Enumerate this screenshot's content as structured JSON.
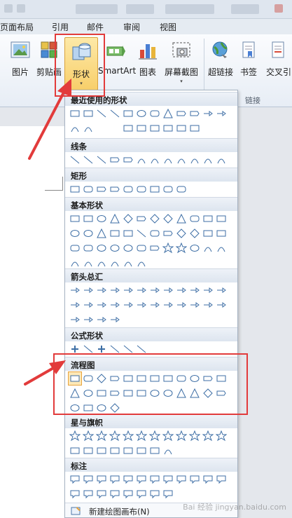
{
  "tabs": [
    "页面布局",
    "引用",
    "邮件",
    "审阅",
    "视图"
  ],
  "ribbon": {
    "buttons": [
      {
        "label": "图片",
        "icon": "picture-icon"
      },
      {
        "label": "剪贴画",
        "icon": "clipart-icon"
      },
      {
        "label": "形状",
        "icon": "shapes-icon",
        "dropdown": "▾"
      },
      {
        "label": "SmartArt",
        "icon": "smartart-icon"
      },
      {
        "label": "图表",
        "icon": "chart-icon"
      },
      {
        "label": "屏幕截图",
        "icon": "screenshot-icon",
        "dropdown": "▾"
      },
      {
        "label": "超链接",
        "icon": "hyperlink-icon"
      },
      {
        "label": "书签",
        "icon": "bookmark-icon"
      },
      {
        "label": "交叉引",
        "icon": "crossref-icon"
      }
    ],
    "group_links": "链接"
  },
  "gallery": {
    "sections": [
      {
        "title": "最近使用的形状",
        "count": 22
      },
      {
        "title": "线条",
        "count": 12
      },
      {
        "title": "矩形",
        "count": 9
      },
      {
        "title": "基本形状",
        "count": 42
      },
      {
        "title": "箭头总汇",
        "count": 28
      },
      {
        "title": "公式形状",
        "count": 6
      },
      {
        "title": "流程图",
        "count": 28
      },
      {
        "title": "星与旗帜",
        "count": 20
      },
      {
        "title": "标注",
        "count": 20
      }
    ],
    "new_canvas": "新建绘图画布(N)"
  },
  "annotation_color": "#e23b3b",
  "watermark": "Bai 经验 jingyan.baidu.com"
}
